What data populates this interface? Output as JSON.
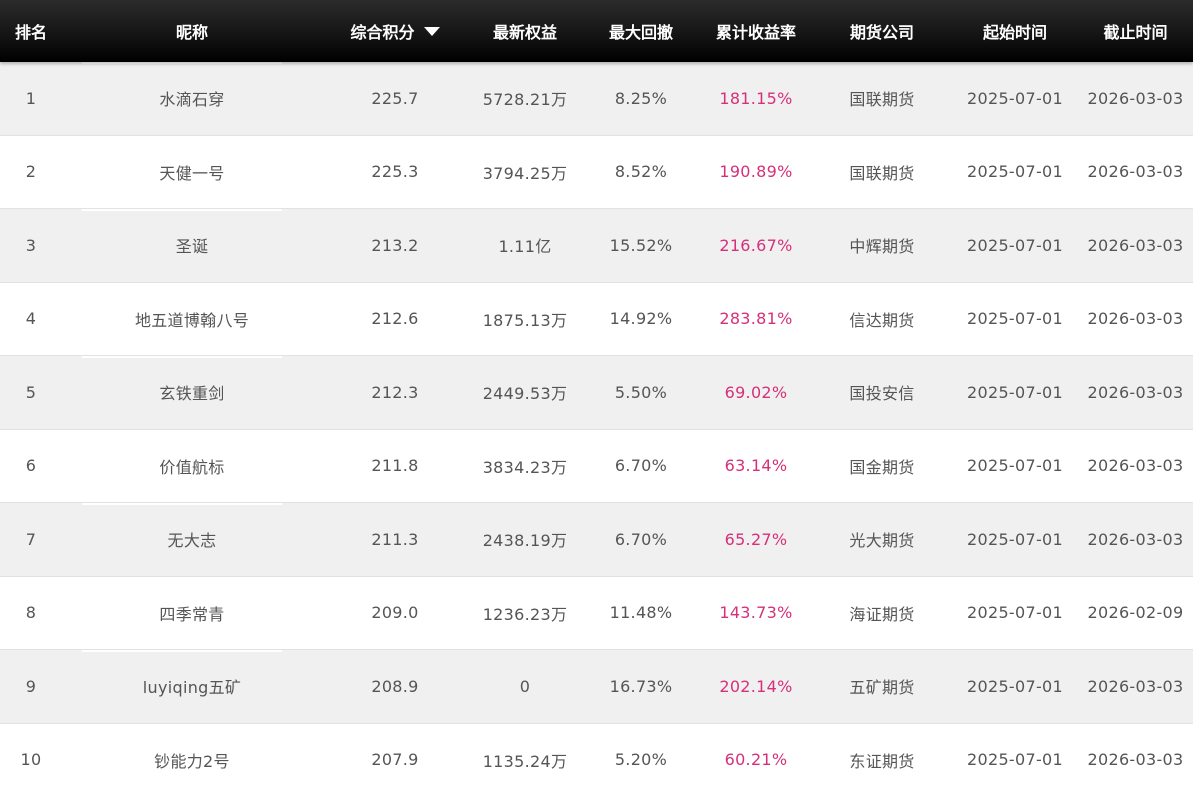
{
  "header": {
    "rank": "排名",
    "nickname": "昵称",
    "score": "综合积分",
    "equity": "最新权益",
    "drawdown": "最大回撤",
    "return": "累计收益率",
    "company": "期货公司",
    "start": "起始时间",
    "end": "截止时间",
    "sort_icon": "caret-down-icon"
  },
  "colors": {
    "header_bg": "#000000",
    "return_text": "#d6307a",
    "row_alt_bg": "#f0f0f0"
  },
  "rows": [
    {
      "rank": "1",
      "name": "水滴石穿",
      "score": "225.7",
      "equity": "5728.21万",
      "drawdown": "8.25%",
      "return": "181.15%",
      "company": "国联期货",
      "start": "2025-07-01",
      "end": "2026-03-03"
    },
    {
      "rank": "2",
      "name": "天健一号",
      "score": "225.3",
      "equity": "3794.25万",
      "drawdown": "8.52%",
      "return": "190.89%",
      "company": "国联期货",
      "start": "2025-07-01",
      "end": "2026-03-03"
    },
    {
      "rank": "3",
      "name": "圣诞",
      "score": "213.2",
      "equity": "1.11亿",
      "drawdown": "15.52%",
      "return": "216.67%",
      "company": "中辉期货",
      "start": "2025-07-01",
      "end": "2026-03-03"
    },
    {
      "rank": "4",
      "name": "地五道博翰八号",
      "score": "212.6",
      "equity": "1875.13万",
      "drawdown": "14.92%",
      "return": "283.81%",
      "company": "信达期货",
      "start": "2025-07-01",
      "end": "2026-03-03"
    },
    {
      "rank": "5",
      "name": "玄铁重剑",
      "score": "212.3",
      "equity": "2449.53万",
      "drawdown": "5.50%",
      "return": "69.02%",
      "company": "国投安信",
      "start": "2025-07-01",
      "end": "2026-03-03"
    },
    {
      "rank": "6",
      "name": "价值航标",
      "score": "211.8",
      "equity": "3834.23万",
      "drawdown": "6.70%",
      "return": "63.14%",
      "company": "国金期货",
      "start": "2025-07-01",
      "end": "2026-03-03"
    },
    {
      "rank": "7",
      "name": "无大志",
      "score": "211.3",
      "equity": "2438.19万",
      "drawdown": "6.70%",
      "return": "65.27%",
      "company": "光大期货",
      "start": "2025-07-01",
      "end": "2026-03-03"
    },
    {
      "rank": "8",
      "name": "四季常青",
      "score": "209.0",
      "equity": "1236.23万",
      "drawdown": "11.48%",
      "return": "143.73%",
      "company": "海证期货",
      "start": "2025-07-01",
      "end": "2026-02-09"
    },
    {
      "rank": "9",
      "name": "luyiqing五矿",
      "score": "208.9",
      "equity": "0",
      "drawdown": "16.73%",
      "return": "202.14%",
      "company": "五矿期货",
      "start": "2025-07-01",
      "end": "2026-03-03"
    },
    {
      "rank": "10",
      "name": "钞能力2号",
      "score": "207.9",
      "equity": "1135.24万",
      "drawdown": "5.20%",
      "return": "60.21%",
      "company": "东证期货",
      "start": "2025-07-01",
      "end": "2026-03-03"
    }
  ]
}
